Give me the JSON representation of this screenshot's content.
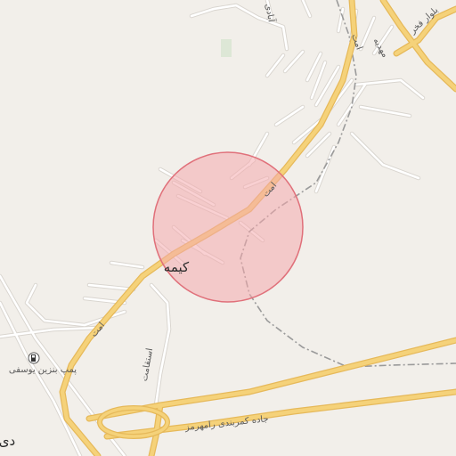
{
  "map": {
    "colors": {
      "background": "#f2efea",
      "major_road": "#f5d27a",
      "major_road_casing": "#e6b95a",
      "minor_road": "#ffffff",
      "minor_road_casing": "#d9d5cf",
      "railway": "#9a9a9a",
      "circle_fill": "#f4a9ad",
      "circle_stroke": "#e0707a",
      "park": "#dde7d6"
    },
    "labels": {
      "town": "کیمه",
      "gas_station": "پمپ بنزین یوسفی",
      "road_south": "جاده کمربندی رامهرمز",
      "street_amat_1": "امت",
      "street_amat_2": "امت",
      "street_amat_3": "امت",
      "street_esteqamat": "استقامت",
      "street_north": "مهدیه",
      "street_ne": "بلوار فخر",
      "street_nw": "آبادی",
      "edge_town": "دی"
    },
    "icons": {
      "gas_station": "fuel-pump-icon"
    }
  }
}
